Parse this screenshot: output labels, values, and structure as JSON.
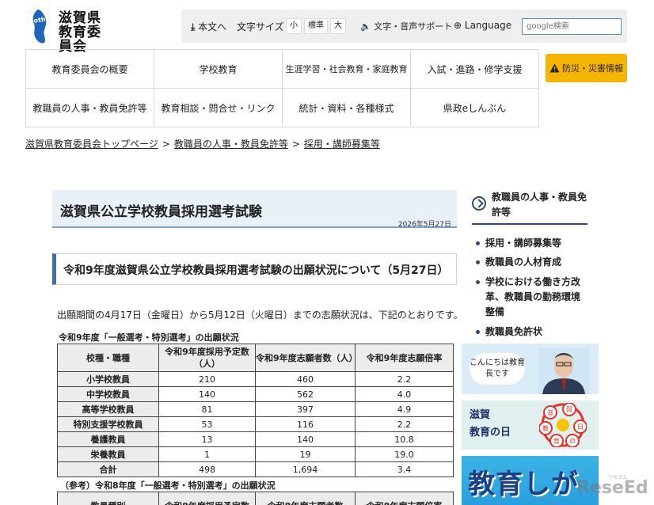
{
  "header": {
    "logo_mark_text": "Mother Lake",
    "logo_line1": "滋賀県",
    "logo_line2": "教育委員会",
    "skip_link": "本文へ",
    "font_size_label": "文字サイズ",
    "font_sizes": [
      "小",
      "標準",
      "大"
    ],
    "voice_support": "文字・音声サポート",
    "language": "Language",
    "search_placeholder": "google検索"
  },
  "nav": {
    "items": [
      "教育委員会の概要",
      "学校教育",
      "生涯学習・社会教育・家庭教育",
      "入試・進路・修学支援",
      "教職員の人事・教員免許等",
      "教育相談・問合せ・リンク",
      "統計・資料・各種様式",
      "県政eしんぶん"
    ],
    "disaster": "防災・災害情報"
  },
  "breadcrumb": {
    "items": [
      "滋賀県教育委員会トップページ",
      "教職員の人事・教員免許等",
      "採用・講師募集等"
    ],
    "separator": ">"
  },
  "main": {
    "title": "滋賀県公立学校教員採用選考試験",
    "date": "2026年5月27日",
    "section_heading": "令和9年度滋賀県公立学校教員採用選考試験の出願状況について（5月27日）",
    "intro": "出願期間の4月17日（金曜日）から5月12日（火曜日）までの志願状況は、下記のとおりです。",
    "table1": {
      "caption": "令和9年度「一般選考・特別選考」の出願状況",
      "headers": [
        "校種・職種",
        "令和9年度採用予定数（人）",
        "令和9年度志願者数（人）",
        "令和9年度志願倍率"
      ],
      "rows": [
        [
          "小学校教員",
          "210",
          "460",
          "2.2"
        ],
        [
          "中学校教員",
          "140",
          "562",
          "4.0"
        ],
        [
          "高等学校教員",
          "81",
          "397",
          "4.9"
        ],
        [
          "特別支援学校教員",
          "53",
          "116",
          "2.2"
        ],
        [
          "養護教員",
          "13",
          "140",
          "10.8"
        ],
        [
          "栄養教員",
          "1",
          "19",
          "19.0"
        ],
        [
          "合計",
          "498",
          "1,694",
          "3.4"
        ]
      ]
    },
    "table2": {
      "caption": "（参考）令和8年度「一般選考・特別選考」の出願状況",
      "headers": [
        "教員種別",
        "令和8年度採用予定数",
        "令和8年度志願者数",
        "令和8年度志願倍率"
      ]
    }
  },
  "sidebar": {
    "heading": "教職員の人事・教員免許等",
    "items": [
      "採用・講師募集等",
      "教職員の人材育成",
      "学校における働き方改革、教職員の勤務環境整備",
      "教職員免許状"
    ],
    "banner1_text": "こんにちは教育長です",
    "banner2_text_line1": "滋賀",
    "banner2_text_line2": "教育の日",
    "banner2_circles": [
      "滋",
      "賀",
      "教",
      "日",
      "育",
      "の"
    ],
    "banner3_text": "教育しが"
  },
  "watermark": {
    "text": "ReseEd",
    "small": "リセマム"
  },
  "colors": {
    "accent_blue": "#3f6fa0",
    "title_bg": "#e8f1f8",
    "disaster_bg": "#f5b400",
    "banner3_bg": "#3bb3e6"
  }
}
